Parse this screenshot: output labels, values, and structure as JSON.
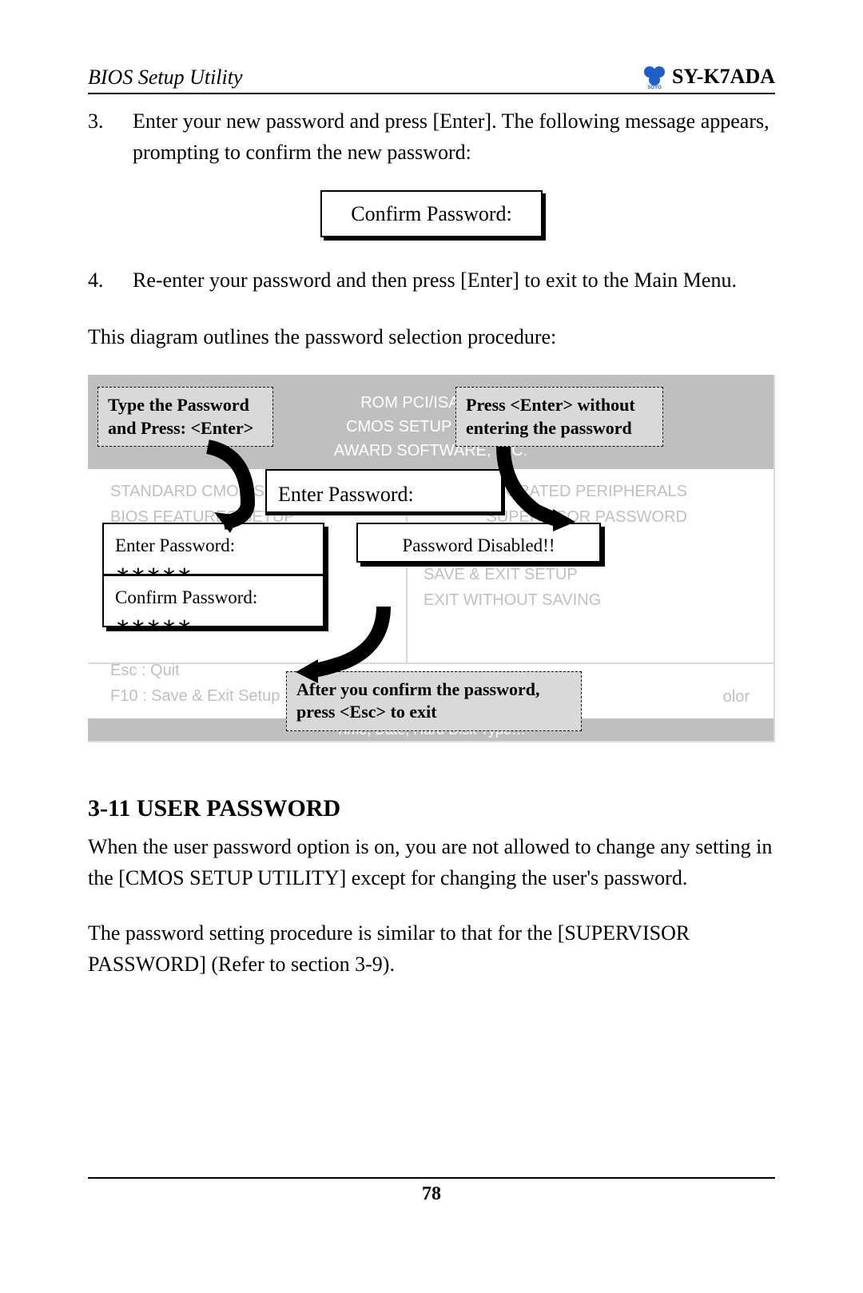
{
  "header": {
    "left": "BIOS Setup Utility",
    "right": "SY-K7ADA",
    "logo_caption": "SOYO"
  },
  "steps": {
    "s3_num": "3.",
    "s3_text": "Enter your new password and press [Enter]. The following message appears, prompting to confirm the new password:",
    "confirm_box": "Confirm Password:",
    "s4_num": "4.",
    "s4_text": "Re-enter your password and then press [Enter] to exit to the Main Menu."
  },
  "diagram_intro": "This diagram outlines the password selection procedure:",
  "diagram": {
    "top_line1": "ROM PCI/ISA BIOS",
    "top_line2": "CMOS SETUP UTILITY",
    "top_line3": "AWARD SOFTWARE, INC.",
    "menu_left": [
      "STANDARD CMOS SETUP",
      "BIOS FEATURES SETUP"
    ],
    "menu_right": [
      "INTEGRATED PERIPHERALS",
      "SUPERVISOR PASSWORD",
      "",
      "SAVE & EXIT SETUP",
      "EXIT WITHOUT SAVING"
    ],
    "footer_left": [
      "Esc   : Quit",
      "F10  : Save & Exit Setup"
    ],
    "footer_right_hint": "olor",
    "bottom_bar": "Time, Date, Hard Disk Type…",
    "callout_tl": "Type the Password and Press: <Enter>",
    "callout_tr": "Press <Enter> without entering the password",
    "callout_bot": "After you confirm the password, press <Esc> to exit",
    "box_enter_big": "Enter Password:",
    "box_enter": "Enter Password: ∗∗∗∗∗",
    "box_confirm": "Confirm Password: ∗∗∗∗∗",
    "box_disabled": "Password Disabled!!"
  },
  "section": {
    "title": "3-11  USER PASSWORD",
    "para1": "When the user password option is on, you are not allowed to change any setting in the [CMOS SETUP UTILITY] except for changing the user's password.",
    "para2": "The password setting procedure is similar to that for the [SUPERVISOR PASSWORD] (Refer to section 3-9)."
  },
  "page_number": "78"
}
